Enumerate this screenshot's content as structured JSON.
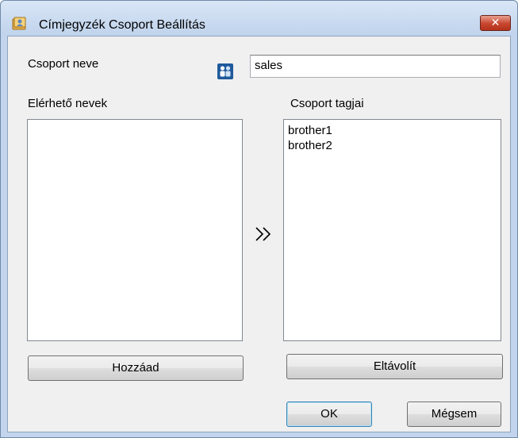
{
  "window": {
    "title": "Címjegyzék Csoport Beállítás",
    "icons": {
      "app": "address-book-icon",
      "close": "close-icon"
    }
  },
  "form": {
    "group_name_label": "Csoport neve",
    "group_icon": "group-people-icon",
    "group_name_value": "sales",
    "available_label": "Elérhető nevek",
    "available_items": [],
    "members_label": "Csoport tagjai",
    "members_items": [
      "brother1",
      "brother2"
    ],
    "transfer_icon": "double-chevron-right-icon"
  },
  "buttons": {
    "add": "Hozzáad",
    "remove": "Eltávolít",
    "ok": "OK",
    "cancel": "Mégsem"
  },
  "colors": {
    "title_bar": "#c2d5ec",
    "close_button": "#c8452d",
    "dialog_bg": "#f0f0f0"
  }
}
